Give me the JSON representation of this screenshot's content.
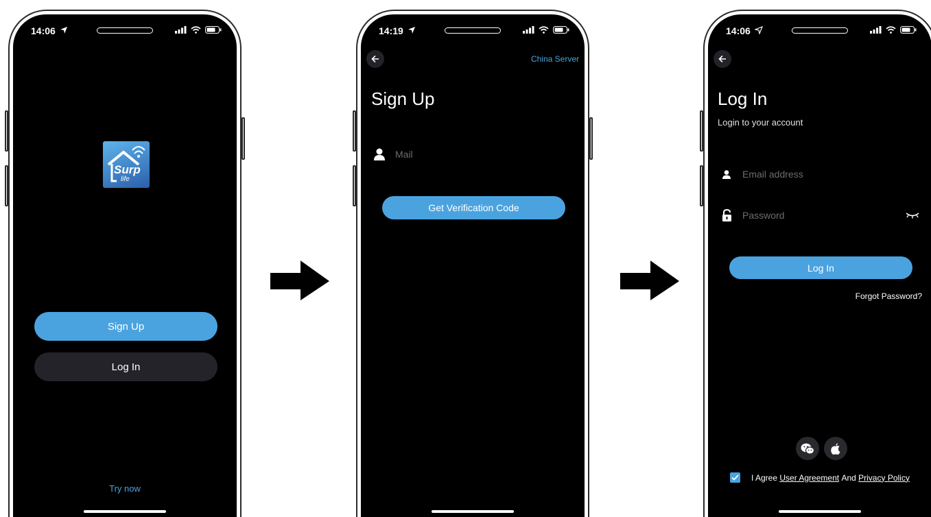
{
  "colors": {
    "accent": "#4aa3df",
    "screen_bg": "#000000",
    "dark_button": "#25232a"
  },
  "welcome": {
    "time": "14:06",
    "logo_text": "Surp",
    "logo_sub": "life",
    "signup_label": "Sign Up",
    "login_label": "Log In",
    "try_now": "Try now"
  },
  "signup": {
    "time": "14:19",
    "server_label": "China Server",
    "title": "Sign Up",
    "mail_placeholder": "Mail",
    "verify_button": "Get Verification Code"
  },
  "login": {
    "time": "14:06",
    "title": "Log In",
    "subtitle": "Login to your account",
    "email_placeholder": "Email address",
    "password_placeholder": "Password",
    "login_button": "Log In",
    "forgot": "Forgot Password?",
    "agree_prefix": "I Agree",
    "user_agreement": "User Agreement",
    "and": "And",
    "privacy_policy": "Privacy Policy",
    "agreement_checked": true
  }
}
